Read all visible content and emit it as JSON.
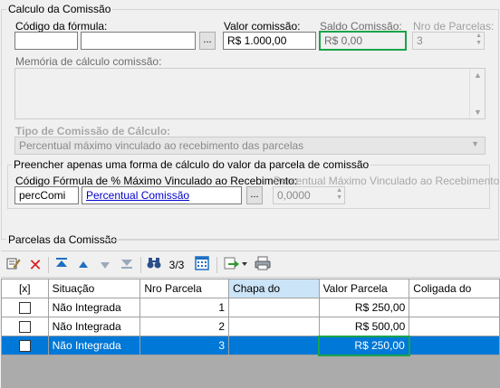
{
  "calc": {
    "title": "Calculo da Comissão",
    "codigo_formula_label": "Código da fórmula:",
    "codigo_formula_value1": "",
    "codigo_formula_value2": "",
    "lookup_label": "...",
    "valor_comissao_label": "Valor comissão:",
    "valor_comissao_value": "R$ 1.000,00",
    "saldo_comissao_label": "Saldo Comissão:",
    "saldo_comissao_value": "R$ 0,00",
    "nro_parcelas_label": "Nro de Parcelas:",
    "nro_parcelas_value": "3",
    "memoria_label": "Memória de cálculo comissão:",
    "memoria_value": "",
    "tipo_label": "Tipo de Comissão de Cálculo:",
    "tipo_value": "Percentual máximo vinculado ao recebimento das parcelas"
  },
  "preencher": {
    "title": "Preencher apenas uma forma de cálculo do valor da parcela de comissão",
    "codigo_label": "Código Fórmula de % Máximo Vinculado ao Recebimento:",
    "codigo_value": "percComi",
    "codigo_link": "Percentual Comissão",
    "lookup_label": "...",
    "percentual_label": "Percentual Máximo Vinculado ao Recebimento:",
    "percentual_value": "0,0000"
  },
  "parcelas": {
    "title": "Parcelas da Comissão",
    "toolbar": {
      "edit_icon": "edit-icon",
      "delete_icon": "delete-icon",
      "first_icon": "first-record-icon",
      "prev_icon": "previous-record-icon",
      "next_icon": "next-record-icon",
      "last_icon": "last-record-icon",
      "search_icon": "binoculars-icon",
      "record_counter": "3/3",
      "calendar_icon": "calendar-icon",
      "export_icon": "export-icon",
      "print_icon": "print-icon"
    },
    "columns": [
      "[x]",
      "Situação",
      "Nro Parcela",
      "Chapa do",
      "Valor Parcela",
      "Coligada do"
    ],
    "rows": [
      {
        "situacao": "Não Integrada",
        "nro": "1",
        "chapa": "",
        "valor": "R$ 250,00",
        "coligada": ""
      },
      {
        "situacao": "Não Integrada",
        "nro": "2",
        "chapa": "",
        "valor": "R$ 500,00",
        "coligada": ""
      },
      {
        "situacao": "Não Integrada",
        "nro": "3",
        "chapa": "",
        "valor": "R$ 250,00",
        "coligada": ""
      }
    ],
    "selected_row": 3
  },
  "colors": {
    "accent_highlight": "#1aa34a",
    "selection": "#0078d7",
    "header_selected": "#cce4f7",
    "link": "#0000cc",
    "delete_red": "#d42020"
  }
}
